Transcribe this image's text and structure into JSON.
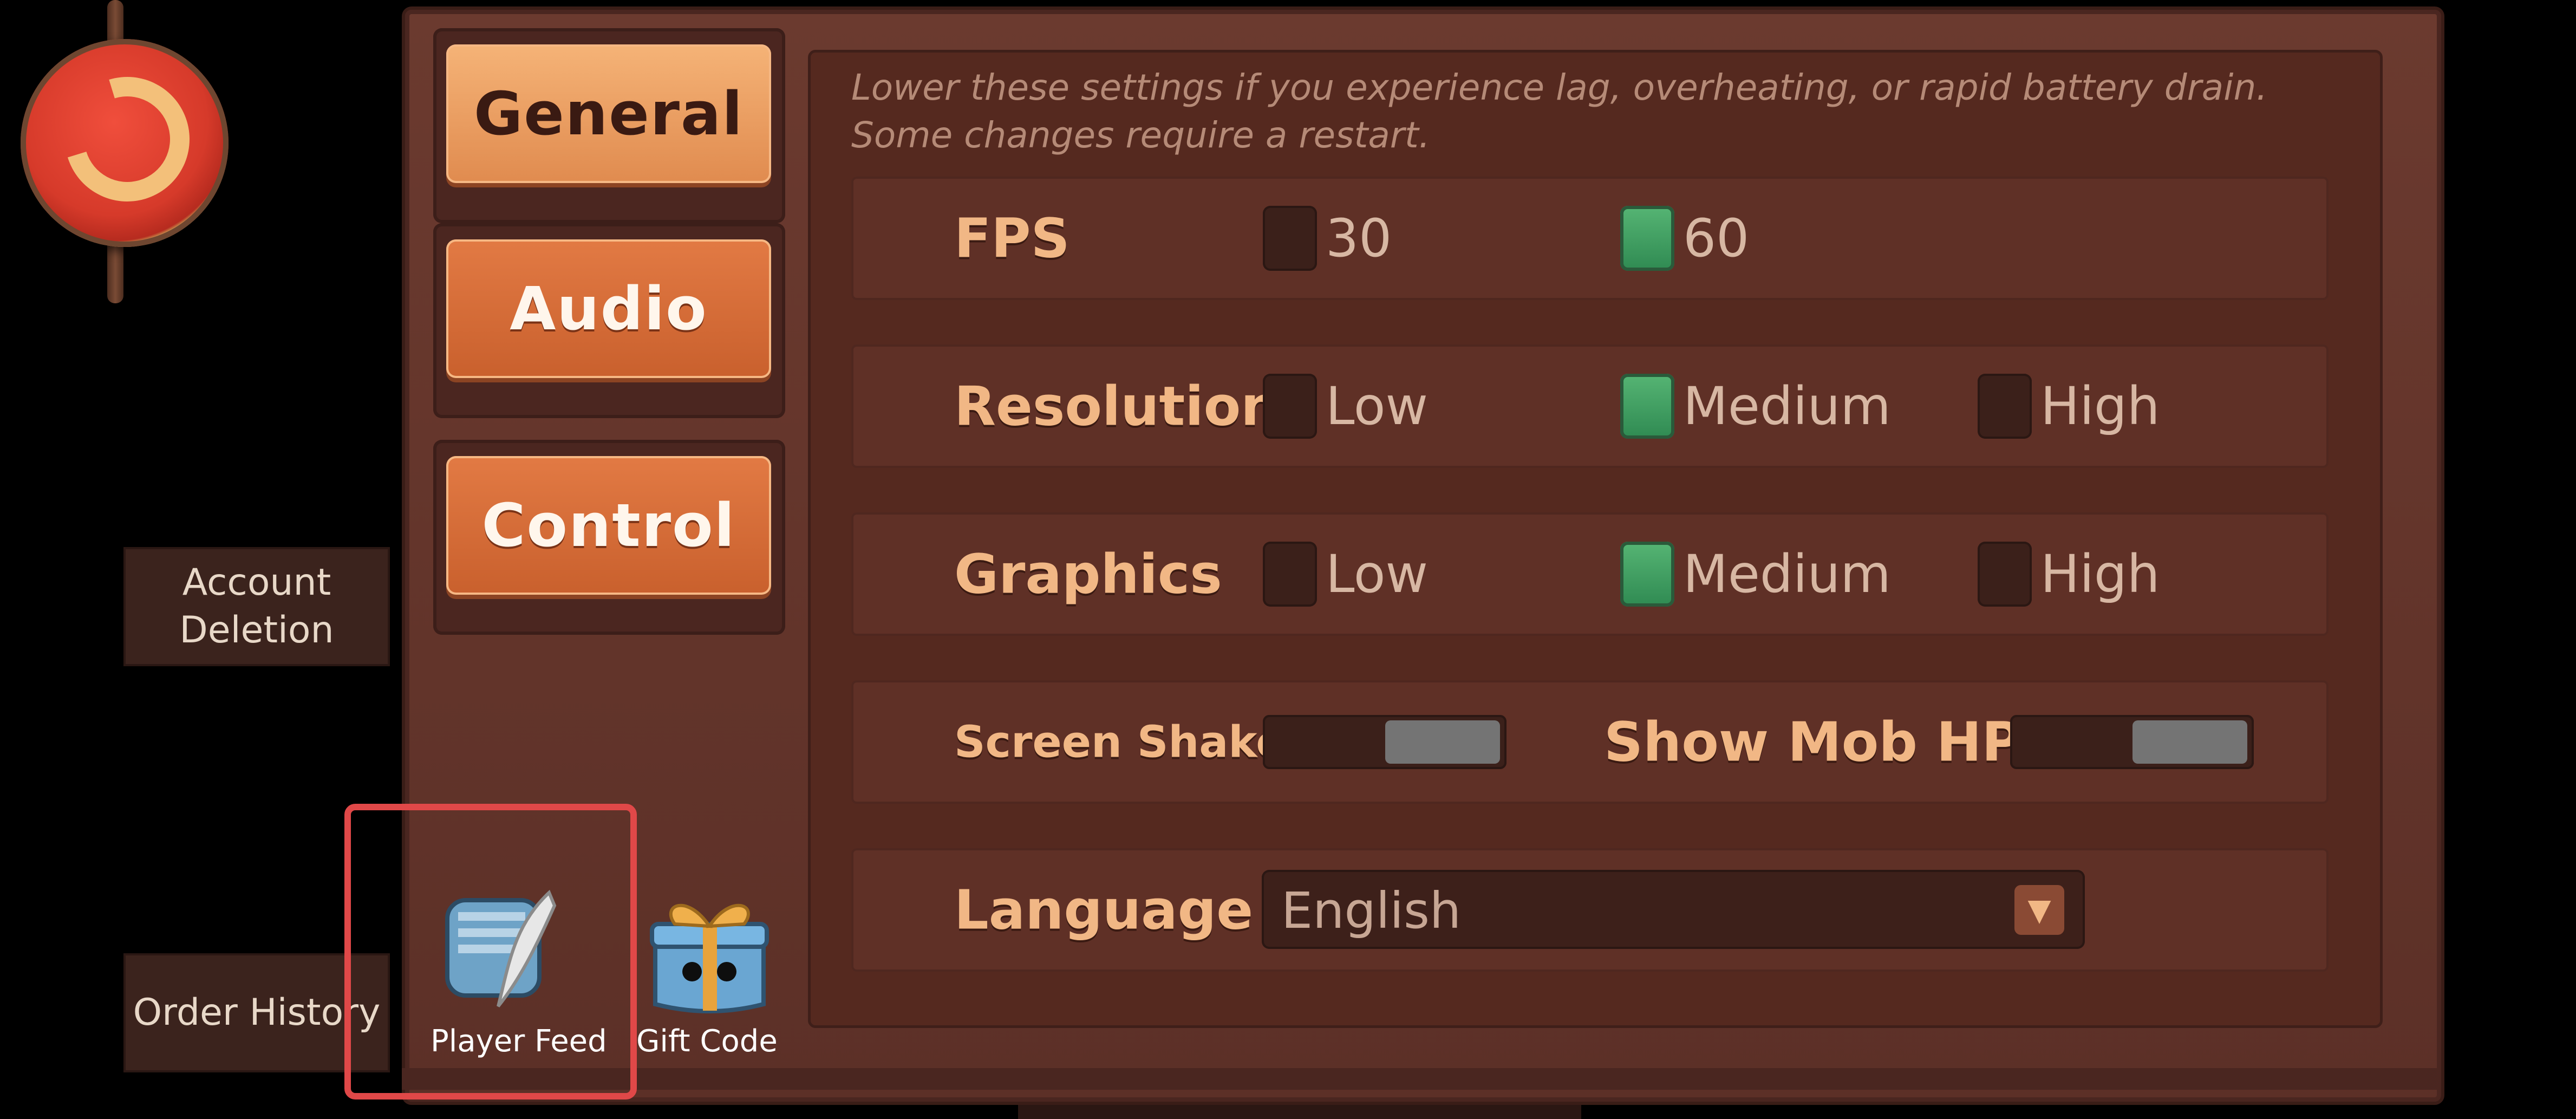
{
  "tabs": [
    {
      "label": "General",
      "selected": true
    },
    {
      "label": "Audio",
      "selected": false
    },
    {
      "label": "Control",
      "selected": false
    }
  ],
  "side_buttons": {
    "account_deletion": "Account Deletion",
    "order_history": "Order History"
  },
  "note": "Lower these settings if you experience lag, overheating, or rapid battery drain. Some changes require a restart.",
  "settings": {
    "fps": {
      "label": "FPS",
      "options": [
        {
          "label": "30",
          "checked": false
        },
        {
          "label": "60",
          "checked": true
        }
      ]
    },
    "resolution": {
      "label": "Resolution",
      "options": [
        {
          "label": "Low",
          "checked": false
        },
        {
          "label": "Medium",
          "checked": true
        },
        {
          "label": "High",
          "checked": false
        }
      ]
    },
    "graphics": {
      "label": "Graphics",
      "options": [
        {
          "label": "Low",
          "checked": false
        },
        {
          "label": "Medium",
          "checked": true
        },
        {
          "label": "High",
          "checked": false
        }
      ]
    },
    "screen_shake": {
      "label": "Screen Shake",
      "enabled": false
    },
    "show_mob_hp": {
      "label": "Show Mob HP",
      "enabled": false
    },
    "language": {
      "label": "Language",
      "value": "English"
    }
  },
  "bottom_icons": {
    "player_feed": "Player Feed",
    "gift_code": "Gift Code"
  },
  "colors": {
    "panel": "#6b3a2f",
    "accent_checkbox_on": "#2f8a52",
    "tab_orange": "#e08b4f",
    "highlight_border": "#e04848"
  },
  "icons": {
    "emblem": "dragon-emblem-icon",
    "player_feed": "scroll-quill-icon",
    "gift_code": "gift-box-icon",
    "language_caret": "chevron-down-icon"
  }
}
